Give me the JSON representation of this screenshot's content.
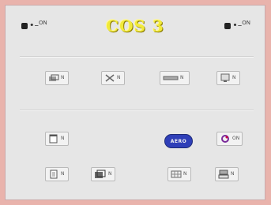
{
  "title": "COS 3",
  "corner": {
    "left_mark": "•–",
    "left_sup": "ON",
    "right_mark": "•–",
    "right_sup": "ON"
  },
  "buttons": {
    "row1": [
      {
        "name": "stack-icon",
        "label": "N"
      },
      {
        "name": "cross-icon",
        "label": "N"
      },
      {
        "name": "strip-icon",
        "label": "N"
      },
      {
        "name": "screen-icon",
        "label": "N"
      }
    ],
    "row2": [
      {
        "name": "page-icon",
        "label": "N"
      },
      {
        "name": "pill-badge-icon",
        "label": "AERO"
      },
      {
        "name": "swirl-icon",
        "label": "ON"
      }
    ],
    "row3": [
      {
        "name": "doc-icon",
        "label": "N"
      },
      {
        "name": "cube-icon",
        "label": "N"
      },
      {
        "name": "grid-icon",
        "label": "N"
      },
      {
        "name": "tray-icon",
        "label": "N"
      }
    ]
  }
}
